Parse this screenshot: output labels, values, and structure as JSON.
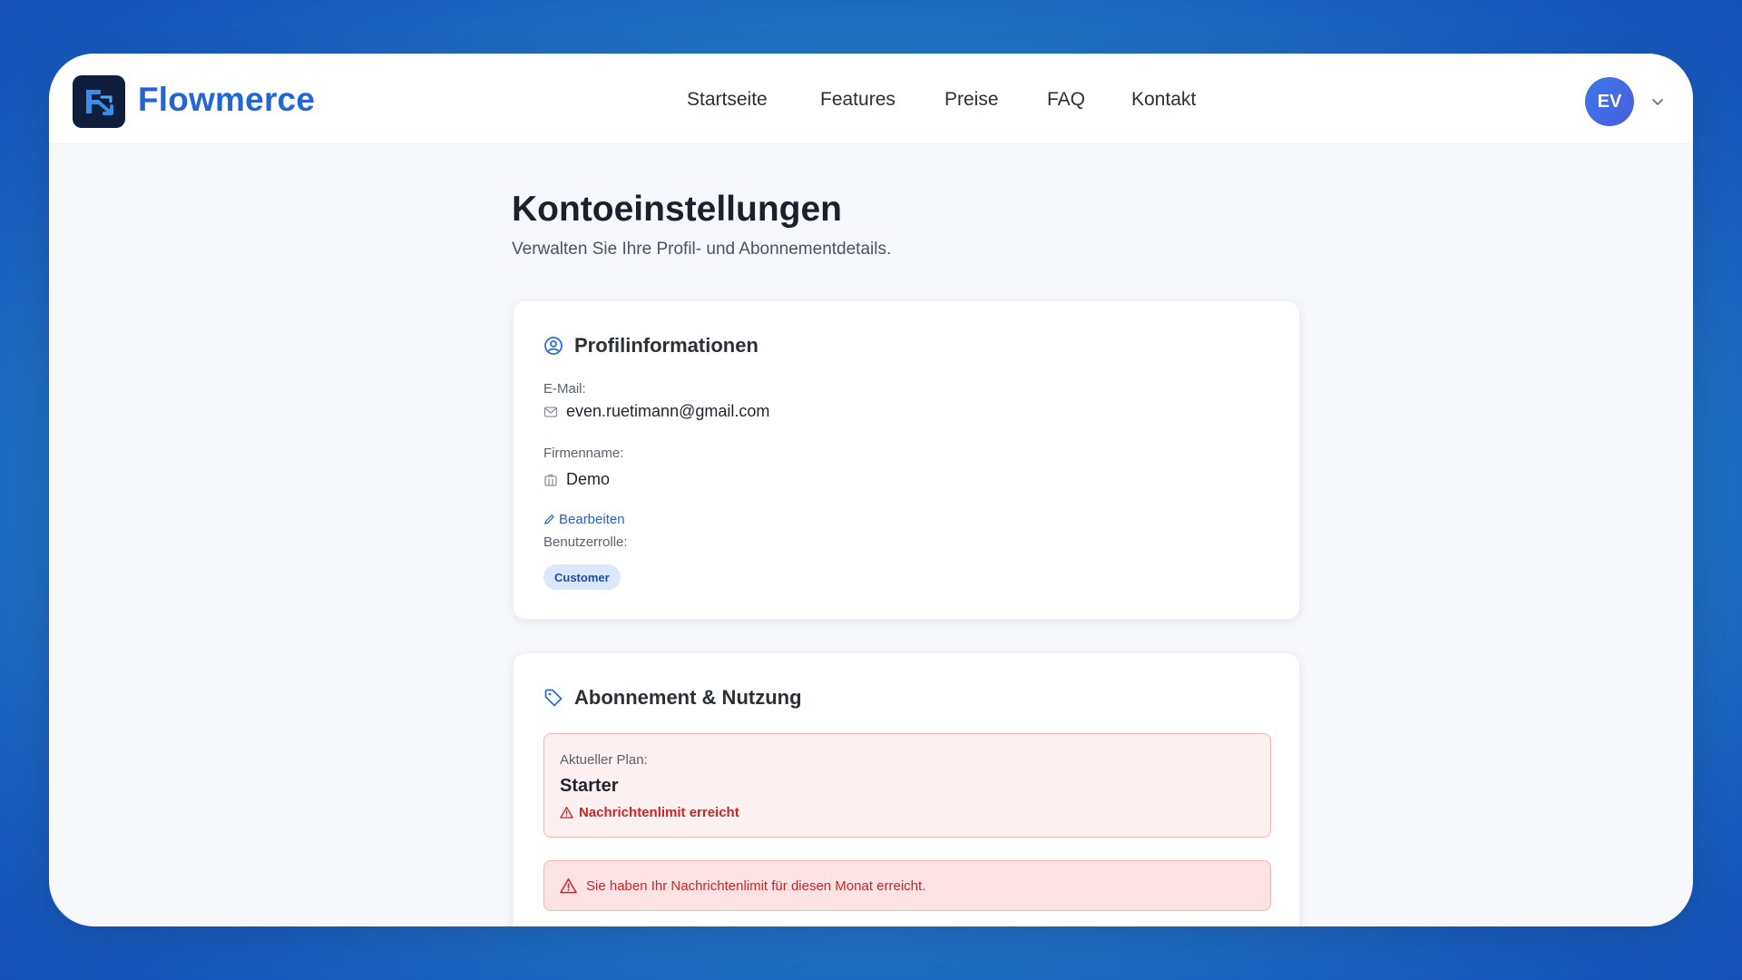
{
  "app": {
    "brand": "Flowmerce",
    "logo_icon": "flowmerce-logo-icon"
  },
  "nav": {
    "items": [
      {
        "label": "Startseite"
      },
      {
        "label": "Features"
      },
      {
        "label": "Preise"
      },
      {
        "label": "FAQ"
      },
      {
        "label": "Kontakt"
      }
    ]
  },
  "user": {
    "initials": "EV"
  },
  "page": {
    "title": "Kontoeinstellungen",
    "subtitle": "Verwalten Sie Ihre Profil- und Abonnementdetails."
  },
  "profile": {
    "title": "Profilinformationen",
    "icon": "user-circle-icon",
    "email_label": "E-Mail:",
    "email_value": "even.ruetimann@gmail.com",
    "company_label": "Firmenname:",
    "company_value": "Demo",
    "edit_label": "Bearbeiten",
    "role_label": "Benutzerrolle:",
    "role_value": "Customer"
  },
  "subscription": {
    "title": "Abonnement & Nutzung",
    "icon": "tag-icon",
    "plan_label": "Aktueller Plan:",
    "plan_name": "Starter",
    "plan_warning": "Nachrichtenlimit erreicht",
    "alert_text": "Sie haben Ihr Nachrichtenlimit für diesen Monat erreicht."
  },
  "colors": {
    "brand": "#2266d6",
    "logo_bg": "#0f1e3d",
    "danger": "#c62828",
    "danger_bg": "#fde3e3",
    "badge_bg": "#dbe8fb"
  }
}
